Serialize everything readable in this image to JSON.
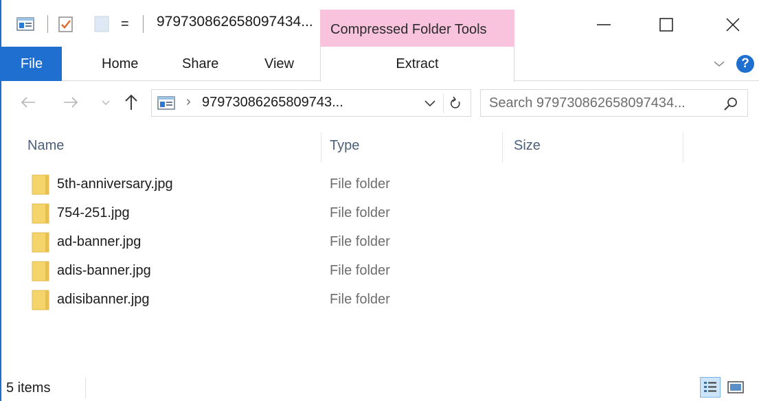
{
  "titlebar": {
    "title": "979730862658097434...",
    "context_tab": "Compressed Folder Tools",
    "qa_separator": "|",
    "qa_dropdown": "="
  },
  "ribbon": {
    "tabs": [
      {
        "label": "File"
      },
      {
        "label": "Home"
      },
      {
        "label": "Share"
      },
      {
        "label": "View"
      },
      {
        "label": "Extract"
      }
    ],
    "help": "?"
  },
  "address": {
    "path": "97973086265809743...",
    "separator": "›",
    "search_placeholder": "Search 979730862658097434..."
  },
  "columns": [
    {
      "label": "Name"
    },
    {
      "label": "Type"
    },
    {
      "label": "Size"
    }
  ],
  "files": [
    {
      "name": "5th-anniversary.jpg",
      "type": "File folder"
    },
    {
      "name": "754-251.jpg",
      "type": "File folder"
    },
    {
      "name": "ad-banner.jpg",
      "type": "File folder"
    },
    {
      "name": "adis-banner.jpg",
      "type": "File folder"
    },
    {
      "name": "adisibanner.jpg",
      "type": "File folder"
    }
  ],
  "status": {
    "item_count": "5 items"
  },
  "colors": {
    "accent": "#1f6fd1",
    "context_tab": "#f9c2dd",
    "folder": "#f5d46c"
  }
}
